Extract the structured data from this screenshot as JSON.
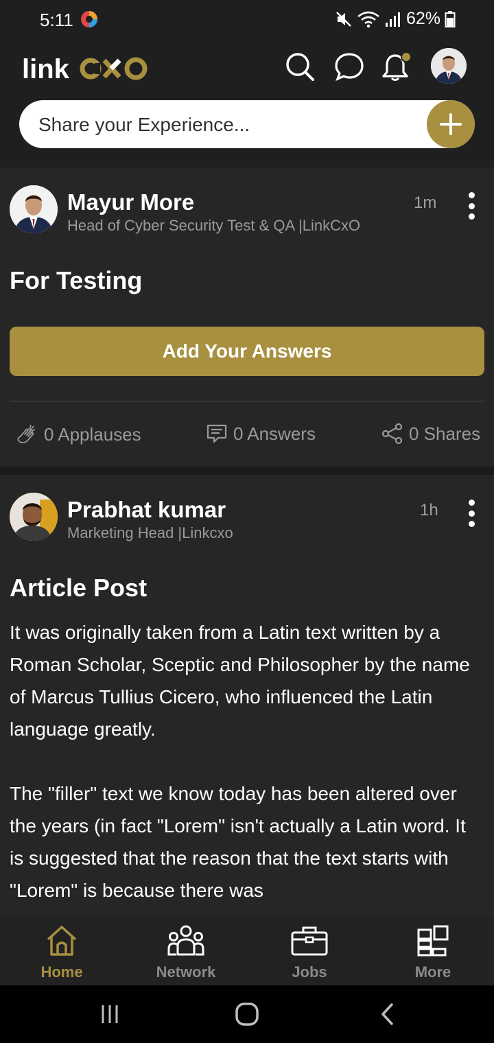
{
  "status_bar": {
    "time": "5:11",
    "battery": "62%"
  },
  "header": {
    "logo_text_1": "link",
    "logo_text_2": "CXO",
    "share_placeholder": "Share your Experience..."
  },
  "posts": [
    {
      "author": "Mayur More",
      "role": "Head of Cyber Security Test & QA |LinkCxO",
      "time": "1m",
      "title": "For Testing",
      "button": "Add Your Answers",
      "applauses": "0 Applauses",
      "answers": "0 Answers",
      "shares": "0 Shares"
    },
    {
      "author": "Prabhat kumar",
      "role": "Marketing Head |Linkcxo",
      "time": "1h",
      "title": "Article Post",
      "paragraph_1": "It was originally taken from a Latin text written by a Roman Scholar, Sceptic and Philosopher by the name of Marcus Tullius Cicero, who influenced the Latin language greatly.",
      "paragraph_2": "The \"filler\" text we know today has been altered over the years (in fact \"Lorem\" isn't actually a Latin word. It is suggested that the reason that the text starts with \"Lorem\" is because there was"
    }
  ],
  "bottom_nav": {
    "items": [
      {
        "label": "Home",
        "active": true
      },
      {
        "label": "Network",
        "active": false
      },
      {
        "label": "Jobs",
        "active": false
      },
      {
        "label": "More",
        "active": false
      }
    ]
  },
  "colors": {
    "accent": "#a89040",
    "background": "#1a1a1a",
    "card": "#262626"
  }
}
